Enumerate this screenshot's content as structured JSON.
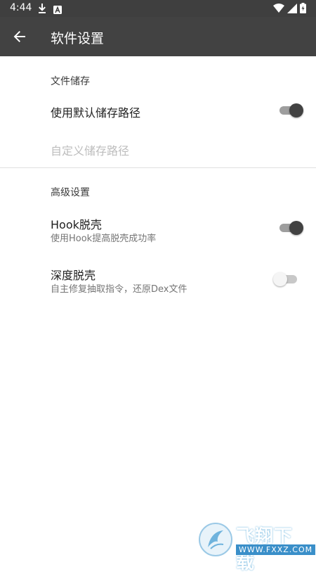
{
  "status_bar": {
    "time": "4:44",
    "icons": [
      "download-icon",
      "a-icon",
      "wifi-icon",
      "signal-icon",
      "battery-icon"
    ]
  },
  "toolbar": {
    "back_icon": "arrow-back-icon",
    "title": "软件设置"
  },
  "sections": {
    "storage": {
      "header": "文件储存",
      "use_default": {
        "title": "使用默认储存路径",
        "enabled": true
      },
      "custom_path": {
        "title": "自定义储存路径",
        "disabled": true
      }
    },
    "advanced": {
      "header": "高级设置",
      "hook": {
        "title": "Hook脱壳",
        "summary": "使用Hook提高脱壳成功率",
        "enabled": true
      },
      "deep": {
        "title": "深度脱壳",
        "summary": "自主修复抽取指令，还原Dex文件",
        "enabled": false
      }
    }
  },
  "colors": {
    "toolbar": "#424242",
    "status_bar": "#3f3f3f",
    "switch_on_thumb": "#424242",
    "switch_on_track": "#9e9e9e",
    "switch_off_thumb": "#f5f5f5",
    "switch_off_track": "#c8c8c8"
  },
  "watermark": {
    "text": "飞翔下载",
    "url": "WWW.FXXZ.COM"
  }
}
